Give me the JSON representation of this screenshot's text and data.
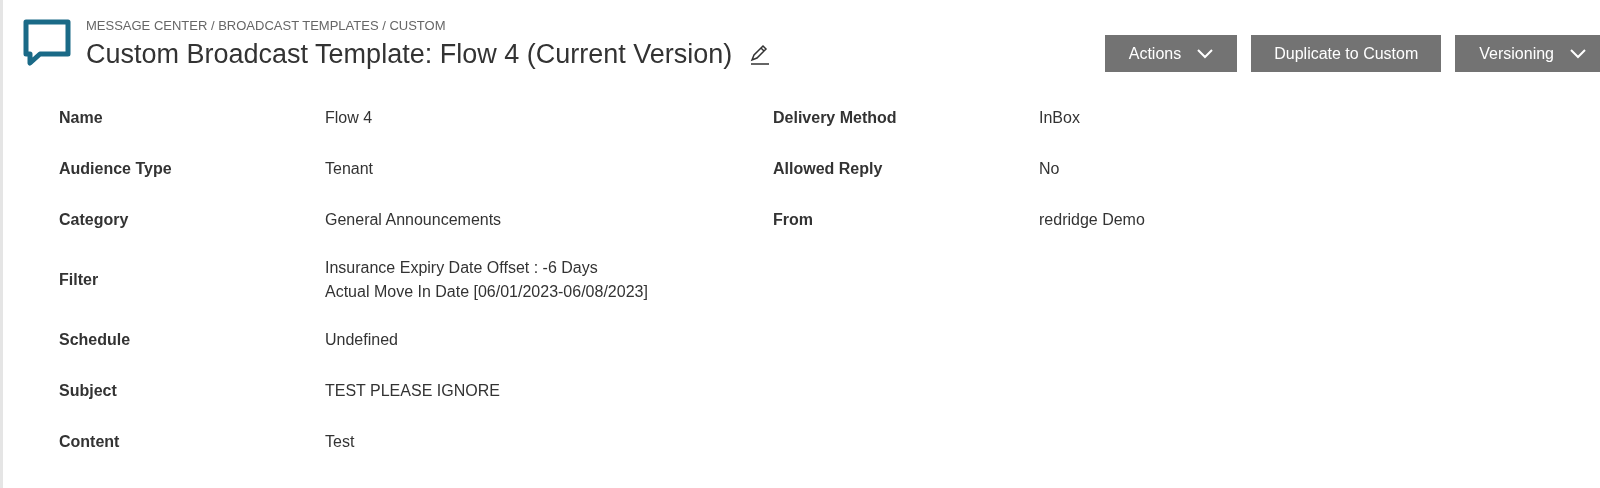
{
  "breadcrumb": "MESSAGE CENTER / BROADCAST TEMPLATES / CUSTOM",
  "title": "Custom Broadcast Template: Flow 4 (Current Version)",
  "buttons": [
    {
      "label": "Actions",
      "dropdown": true
    },
    {
      "label": "Duplicate to Custom",
      "dropdown": false
    },
    {
      "label": "Versioning",
      "dropdown": true
    }
  ],
  "left_fields": [
    {
      "label": "Name",
      "value": [
        "Flow 4"
      ]
    },
    {
      "label": "Audience Type",
      "value": [
        "Tenant"
      ]
    },
    {
      "label": "Category",
      "value": [
        "General Announcements"
      ]
    },
    {
      "label": "Filter",
      "value": [
        "Insurance Expiry Date Offset : -6 Days",
        "Actual Move In Date [06/01/2023-06/08/2023]"
      ]
    },
    {
      "label": "Schedule",
      "value": [
        "Undefined"
      ]
    },
    {
      "label": "Subject",
      "value": [
        "TEST PLEASE IGNORE"
      ]
    },
    {
      "label": "Content",
      "value": [
        "Test"
      ]
    }
  ],
  "right_fields": [
    {
      "label": "Delivery Method",
      "value": [
        "InBox"
      ]
    },
    {
      "label": "Allowed Reply",
      "value": [
        "No"
      ]
    },
    {
      "label": "From",
      "value": [
        "redridge Demo"
      ]
    }
  ]
}
